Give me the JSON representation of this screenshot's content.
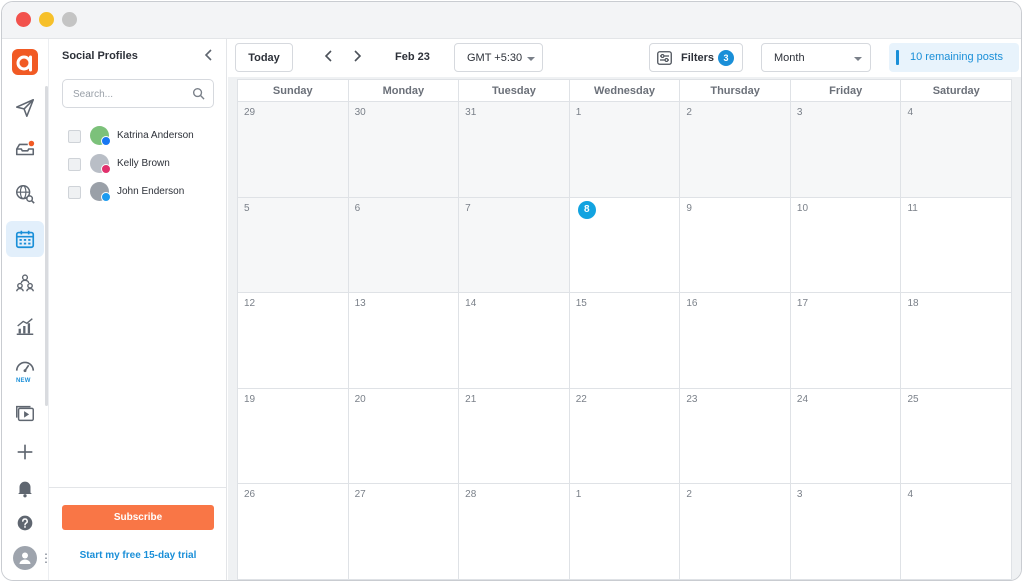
{
  "window": {
    "controls": [
      "close",
      "minimize",
      "zoom"
    ]
  },
  "rail": {
    "items": [
      {
        "name": "logo",
        "icon": "app-logo-icon"
      },
      {
        "name": "publish",
        "icon": "paper-plane-icon"
      },
      {
        "name": "inbox",
        "icon": "inbox-tray-icon"
      },
      {
        "name": "listening",
        "icon": "globe-search-icon"
      },
      {
        "name": "calendar",
        "icon": "calendar-icon",
        "active": true
      },
      {
        "name": "team",
        "icon": "team-icon"
      },
      {
        "name": "analytics",
        "icon": "bar-chart-icon"
      },
      {
        "name": "reports",
        "icon": "speedometer-icon",
        "badge": "NEW"
      },
      {
        "name": "media",
        "icon": "media-library-icon"
      },
      {
        "name": "add",
        "icon": "plus-icon"
      },
      {
        "name": "notifications",
        "icon": "bell-icon"
      },
      {
        "name": "help",
        "icon": "help-circle-icon"
      },
      {
        "name": "profile",
        "icon": "user-avatar-icon"
      }
    ],
    "new_badge": "NEW"
  },
  "profiles_panel": {
    "title": "Social Profiles",
    "search_placeholder": "Search...",
    "profiles": [
      {
        "name": "Katrina Anderson",
        "network": "facebook",
        "avatar_color": "#7cc17a",
        "network_color": "#1877f2"
      },
      {
        "name": "Kelly Brown",
        "network": "instagram",
        "avatar_color": "#b9bec6",
        "network_color": "#e1306c"
      },
      {
        "name": "John Enderson",
        "network": "twitter",
        "avatar_color": "#9aa0a8",
        "network_color": "#1d9bf0"
      }
    ],
    "subscribe_label": "Subscribe",
    "trial_label": "Start my free 15-day trial"
  },
  "toolbar": {
    "today_label": "Today",
    "date_label": "Feb 23",
    "timezone": "GMT +5:30",
    "filters_label": "Filters",
    "filters_count": "3",
    "view": "Month",
    "remaining_label": "10 remaining posts"
  },
  "calendar": {
    "weekdays": [
      "Sunday",
      "Monday",
      "Tuesday",
      "Wednesday",
      "Thursday",
      "Friday",
      "Saturday"
    ],
    "weeks": [
      [
        "29",
        "30",
        "31",
        "1",
        "2",
        "3",
        "4"
      ],
      [
        "5",
        "6",
        "7",
        "8",
        "9",
        "10",
        "11"
      ],
      [
        "12",
        "13",
        "14",
        "15",
        "16",
        "17",
        "18"
      ],
      [
        "19",
        "20",
        "21",
        "22",
        "23",
        "24",
        "25"
      ],
      [
        "26",
        "27",
        "28",
        "1",
        "2",
        "3",
        "4"
      ]
    ],
    "today": "8"
  },
  "colors": {
    "accent": "#1a8fd8",
    "today": "#12a3e0",
    "subscribe": "#f97646",
    "logo": "#f15a24"
  }
}
